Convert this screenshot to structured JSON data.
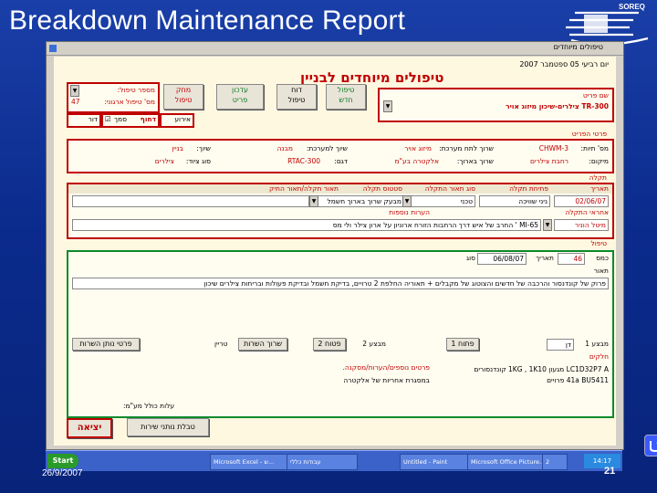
{
  "slide": {
    "title": "Breakdown Maintenance Report",
    "date": "26/9/2007",
    "page_number": "21",
    "logo_text": "SOREQ"
  },
  "window": {
    "title": "טיפולים מיוחדים"
  },
  "form": {
    "date_line": "יום רביעי 05 ספטמבר 2007",
    "title": "טיפולים מיוחדים לבניין",
    "system": {
      "label": "שם פריט",
      "value": "TR-300 צילרים-שיכון מיזוג אויר"
    },
    "buttons": {
      "new_treatment": [
        "טיפול",
        "חדש"
      ],
      "treatment_report": [
        "דוח",
        "טיפול"
      ],
      "update_details": [
        "עדכון",
        "פריט"
      ],
      "delete_treatment": [
        "מחק",
        "טיפול"
      ],
      "exit": "יציאה",
      "contractor_table": "טבלת נותני שירות"
    },
    "treatment_num": {
      "label": "מספר טיפול:",
      "sub_label": "מס' טיפול ארגוני:",
      "value": "47"
    },
    "flags": {
      "event": "אירוע",
      "urgent": "סמך",
      "urgent_value": "דחוף",
      "door": "דור"
    },
    "item_details": {
      "header": "פרטי הפריט",
      "rows": [
        [
          "מס' תיות:",
          "CHWM-3",
          "שרוך לתח מערכת:",
          "מיזוג אויר",
          "שיוך למערכת:",
          "מבנה",
          "שיוך:",
          "בניין"
        ],
        [
          "מיקום:",
          "רחבת צילרים",
          "שרוך בארוך:",
          "אלקטרה בע\"מ",
          "דגם:",
          "RTAC-300",
          "סוג ציוד:",
          "צילרים"
        ]
      ]
    },
    "malfunction": {
      "header": "תקלה",
      "columns": [
        "תאריך",
        "פתיחת תקלה",
        "סוג תאור התקלה",
        "סטטוס תקלה",
        "תאור תקלה/תאור התיק"
      ],
      "row": [
        "02/06/07",
        "ניני שוויכה",
        "טכני",
        "מבעק שרוך בארוך חשמל",
        ""
      ],
      "responsible_label": "אחראי התקלה",
      "extra_label": "הערות נוספות",
      "responsible_value": "מיטל הוניר",
      "extra_value": "MI-65 ' החרב של איש דרך הרחבות הזורח ארוניון על ארון צילר ולי מס"
    },
    "treatment": {
      "header": "טיפול",
      "sub_header": "תאור",
      "cost_label": "כמס",
      "cost_value": "46",
      "date_label": "תאריך",
      "date_value": "06/08/07",
      "type_label": "סוג",
      "description": "פרוק של קונדנסור והרכבה של חדשים והצוטוג של מקבלים + תאוריה החלפת 2 טרויים, בדיקת חשמל ובדיקת פעולות ובריחות צילרים שיכון",
      "row2": [
        "מבצע 1",
        "דן",
        "פתוח 1",
        "פטוח 2",
        "מבצע 2",
        "שרוך השרות",
        "טריין",
        "פרטי נותן השרות"
      ],
      "parts_label": "חלקים",
      "parts_header": "פרטים נוספים/הערות/מסקנה.",
      "parts_value": "LC1D32P7 A מגעון 1KG , 1K10 קונדנסורים",
      "parts_value2": "41a BU5411 פרויים",
      "note_value": "במסגרת אחריות של אלקטרה",
      "cost_total_label": "עלות כולל מע\"מ:"
    }
  },
  "taskbar": {
    "start": "Start",
    "items": [
      "Microsoft Excel - ש...",
      "עבודות כללי",
      "Untitled - Paint",
      "Microsoft Office Picture...",
      "2"
    ],
    "clock": "14:17"
  }
}
